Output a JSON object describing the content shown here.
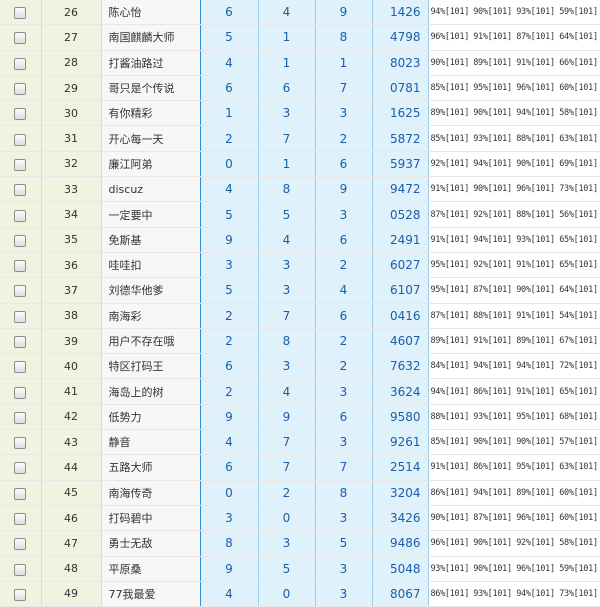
{
  "rows": [
    {
      "index": "26",
      "name": "陈心怡",
      "n1": "6",
      "n2": "4",
      "n3": "9",
      "code": "1426",
      "p1": "94%[101]",
      "p2": "90%[101]",
      "p3": "93%[101]",
      "p4": "59%[101]"
    },
    {
      "index": "27",
      "name": "南国麒麟大师",
      "n1": "5",
      "n2": "1",
      "n3": "8",
      "code": "4798",
      "p1": "96%[101]",
      "p2": "91%[101]",
      "p3": "87%[101]",
      "p4": "64%[101]"
    },
    {
      "index": "28",
      "name": "打酱油路过",
      "n1": "4",
      "n2": "1",
      "n3": "1",
      "code": "8023",
      "p1": "90%[101]",
      "p2": "89%[101]",
      "p3": "91%[101]",
      "p4": "66%[101]"
    },
    {
      "index": "29",
      "name": "哥只是个传说",
      "n1": "6",
      "n2": "6",
      "n3": "7",
      "code": "0781",
      "p1": "85%[101]",
      "p2": "95%[101]",
      "p3": "96%[101]",
      "p4": "60%[101]"
    },
    {
      "index": "30",
      "name": "有你精彩",
      "n1": "1",
      "n2": "3",
      "n3": "3",
      "code": "1625",
      "p1": "89%[101]",
      "p2": "90%[101]",
      "p3": "94%[101]",
      "p4": "58%[101]"
    },
    {
      "index": "31",
      "name": "开心每一天",
      "n1": "2",
      "n2": "7",
      "n3": "2",
      "code": "5872",
      "p1": "85%[101]",
      "p2": "93%[101]",
      "p3": "88%[101]",
      "p4": "63%[101]"
    },
    {
      "index": "32",
      "name": "廉江阿弟",
      "n1": "0",
      "n2": "1",
      "n3": "6",
      "code": "5937",
      "p1": "92%[101]",
      "p2": "94%[101]",
      "p3": "90%[101]",
      "p4": "69%[101]"
    },
    {
      "index": "33",
      "name": "discuz",
      "n1": "4",
      "n2": "8",
      "n3": "9",
      "code": "9472",
      "p1": "91%[101]",
      "p2": "90%[101]",
      "p3": "96%[101]",
      "p4": "73%[101]"
    },
    {
      "index": "34",
      "name": "一定要中",
      "n1": "5",
      "n2": "5",
      "n3": "3",
      "code": "0528",
      "p1": "87%[101]",
      "p2": "92%[101]",
      "p3": "88%[101]",
      "p4": "56%[101]"
    },
    {
      "index": "35",
      "name": "免斯基",
      "n1": "9",
      "n2": "4",
      "n3": "6",
      "code": "2491",
      "p1": "91%[101]",
      "p2": "94%[101]",
      "p3": "93%[101]",
      "p4": "65%[101]"
    },
    {
      "index": "36",
      "name": "哇哇扣",
      "n1": "3",
      "n2": "3",
      "n3": "2",
      "code": "6027",
      "p1": "95%[101]",
      "p2": "92%[101]",
      "p3": "91%[101]",
      "p4": "65%[101]"
    },
    {
      "index": "37",
      "name": "刘德华他爹",
      "n1": "5",
      "n2": "3",
      "n3": "4",
      "code": "6107",
      "p1": "95%[101]",
      "p2": "87%[101]",
      "p3": "90%[101]",
      "p4": "64%[101]"
    },
    {
      "index": "38",
      "name": "南海彩",
      "n1": "2",
      "n2": "7",
      "n3": "6",
      "code": "0416",
      "p1": "87%[101]",
      "p2": "88%[101]",
      "p3": "91%[101]",
      "p4": "54%[101]"
    },
    {
      "index": "39",
      "name": "用户不存在哦",
      "n1": "2",
      "n2": "8",
      "n3": "2",
      "code": "4607",
      "p1": "89%[101]",
      "p2": "91%[101]",
      "p3": "89%[101]",
      "p4": "67%[101]"
    },
    {
      "index": "40",
      "name": "特区打码王",
      "n1": "6",
      "n2": "3",
      "n3": "2",
      "code": "7632",
      "p1": "84%[101]",
      "p2": "94%[101]",
      "p3": "94%[101]",
      "p4": "72%[101]"
    },
    {
      "index": "41",
      "name": "海岛上的树",
      "n1": "2",
      "n2": "4",
      "n3": "3",
      "code": "3624",
      "p1": "94%[101]",
      "p2": "86%[101]",
      "p3": "91%[101]",
      "p4": "65%[101]"
    },
    {
      "index": "42",
      "name": "低势力",
      "n1": "9",
      "n2": "9",
      "n3": "6",
      "code": "9580",
      "p1": "88%[101]",
      "p2": "93%[101]",
      "p3": "95%[101]",
      "p4": "68%[101]"
    },
    {
      "index": "43",
      "name": "静音",
      "n1": "4",
      "n2": "7",
      "n3": "3",
      "code": "9261",
      "p1": "85%[101]",
      "p2": "90%[101]",
      "p3": "90%[101]",
      "p4": "57%[101]"
    },
    {
      "index": "44",
      "name": "五路大师",
      "n1": "6",
      "n2": "7",
      "n3": "7",
      "code": "2514",
      "p1": "91%[101]",
      "p2": "86%[101]",
      "p3": "95%[101]",
      "p4": "63%[101]"
    },
    {
      "index": "45",
      "name": "南海传奇",
      "n1": "0",
      "n2": "2",
      "n3": "8",
      "code": "3204",
      "p1": "86%[101]",
      "p2": "94%[101]",
      "p3": "89%[101]",
      "p4": "60%[101]"
    },
    {
      "index": "46",
      "name": "打码碧中",
      "n1": "3",
      "n2": "0",
      "n3": "3",
      "code": "3426",
      "p1": "90%[101]",
      "p2": "87%[101]",
      "p3": "96%[101]",
      "p4": "60%[101]"
    },
    {
      "index": "47",
      "name": "勇士无敌",
      "n1": "8",
      "n2": "3",
      "n3": "5",
      "code": "9486",
      "p1": "96%[101]",
      "p2": "90%[101]",
      "p3": "92%[101]",
      "p4": "58%[101]"
    },
    {
      "index": "48",
      "name": "平原桑",
      "n1": "9",
      "n2": "5",
      "n3": "3",
      "code": "5048",
      "p1": "93%[101]",
      "p2": "90%[101]",
      "p3": "96%[101]",
      "p4": "59%[101]"
    },
    {
      "index": "49",
      "name": "77我最爱",
      "n1": "4",
      "n2": "0",
      "n3": "3",
      "code": "8067",
      "p1": "86%[101]",
      "p2": "93%[101]",
      "p3": "94%[101]",
      "p4": "73%[101]"
    }
  ]
}
